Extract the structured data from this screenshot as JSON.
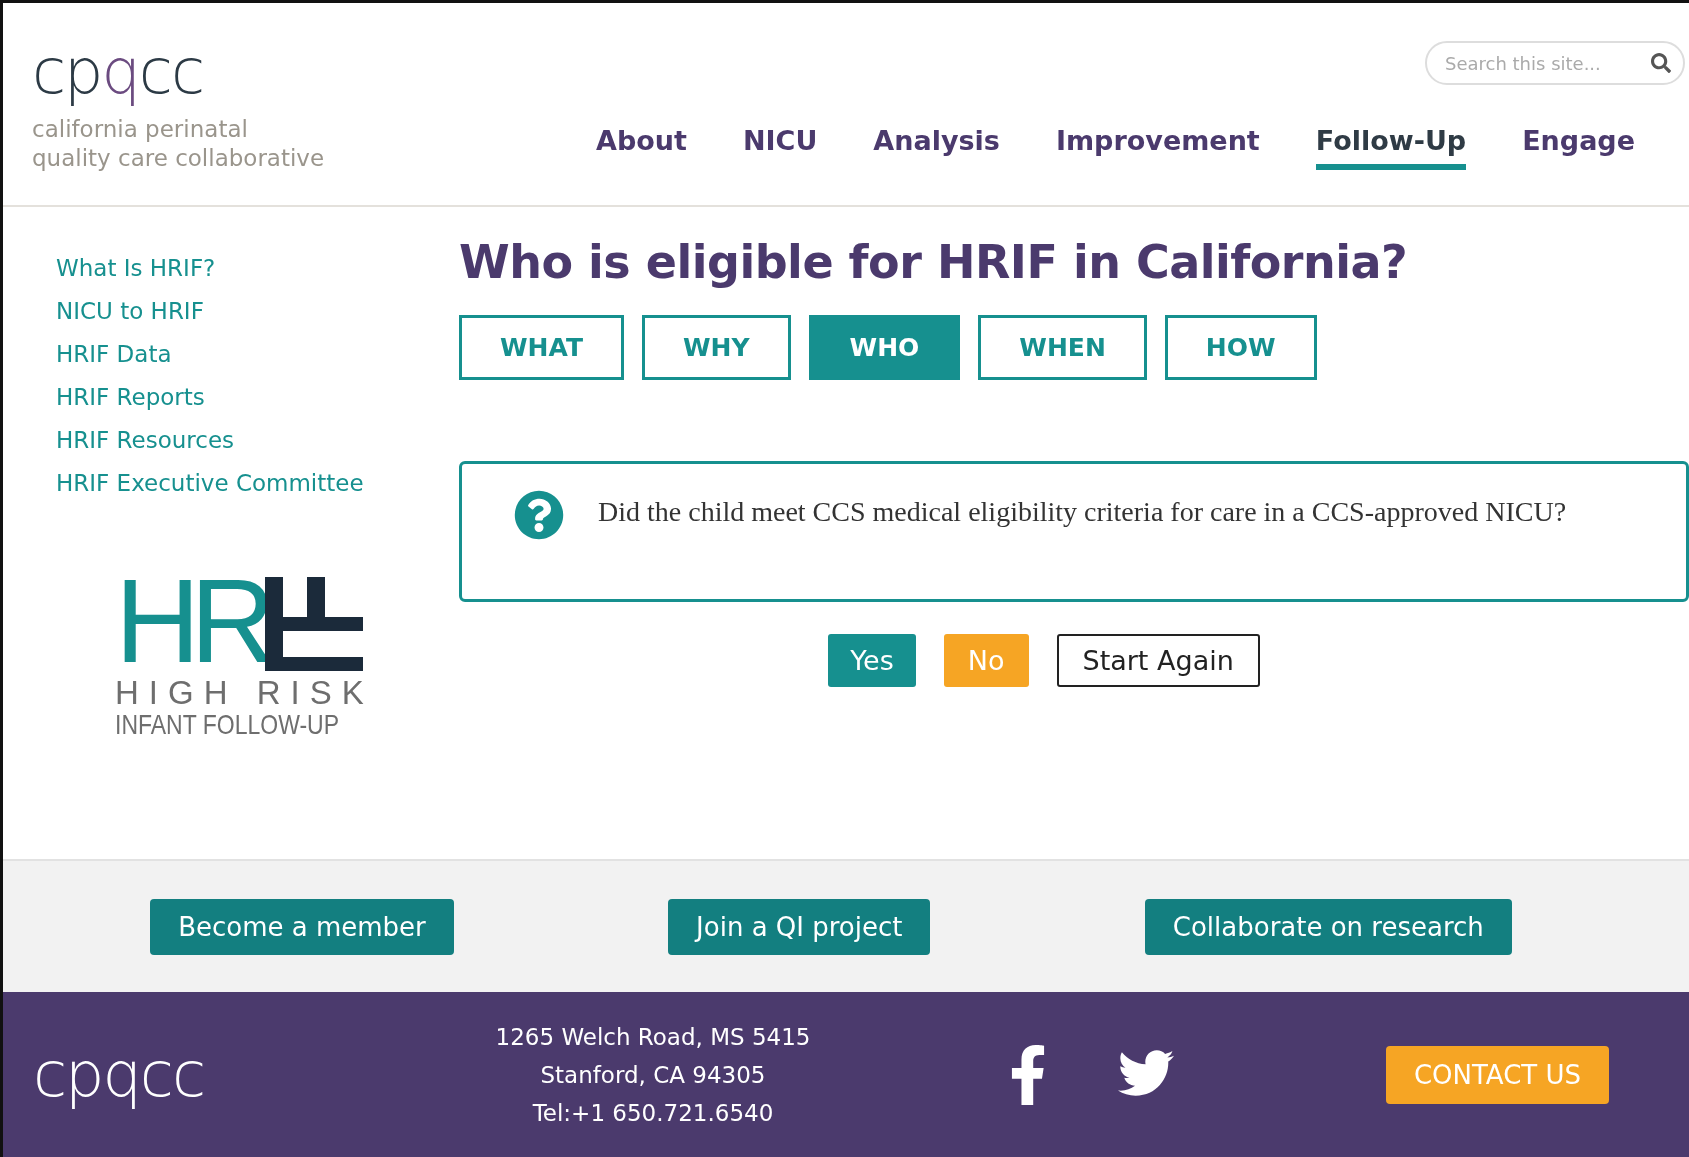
{
  "header": {
    "logo": {
      "parts": [
        "cp",
        "q",
        "cc"
      ],
      "tagline": [
        "california perinatal",
        "quality care collaborative"
      ]
    },
    "search": {
      "placeholder": "Search this site..."
    },
    "nav": [
      {
        "label": "About",
        "selected": false
      },
      {
        "label": "NICU",
        "selected": false
      },
      {
        "label": "Analysis",
        "selected": false
      },
      {
        "label": "Improvement",
        "selected": false
      },
      {
        "label": "Follow-Up",
        "selected": true
      },
      {
        "label": "Engage",
        "selected": false
      }
    ]
  },
  "sidebar": {
    "links": [
      "What Is HRIF?",
      "NICU to HRIF",
      "HRIF Data",
      "HRIF Reports",
      "HRIF Resources",
      "HRIF Executive Committee"
    ],
    "hrif_logo": {
      "mark": "HR",
      "line_1": "HIGH RISK",
      "line_2": "INFANT FOLLOW-UP"
    }
  },
  "main": {
    "title": "Who is eligible for HRIF in California?",
    "tabs": [
      {
        "label": "WHAT",
        "selected": false
      },
      {
        "label": "WHY",
        "selected": false
      },
      {
        "label": "WHO",
        "selected": true
      },
      {
        "label": "WHEN",
        "selected": false
      },
      {
        "label": "HOW",
        "selected": false
      }
    ],
    "question": "Did the child meet CCS medical eligibility criteria for care in a CCS-approved NICU?",
    "answers": [
      {
        "label": "Yes",
        "kind": "yes"
      },
      {
        "label": "No",
        "kind": "no"
      },
      {
        "label": "Start Again",
        "kind": "reset"
      }
    ]
  },
  "cta": [
    "Become a member",
    "Join a QI project",
    "Collaborate on research"
  ],
  "footer": {
    "logo": "cpqcc",
    "address": [
      "1265 Welch Road, MS 5415",
      "Stanford, CA 94305",
      "Tel:+1 650.721.6540"
    ],
    "contact": "CONTACT US"
  }
}
